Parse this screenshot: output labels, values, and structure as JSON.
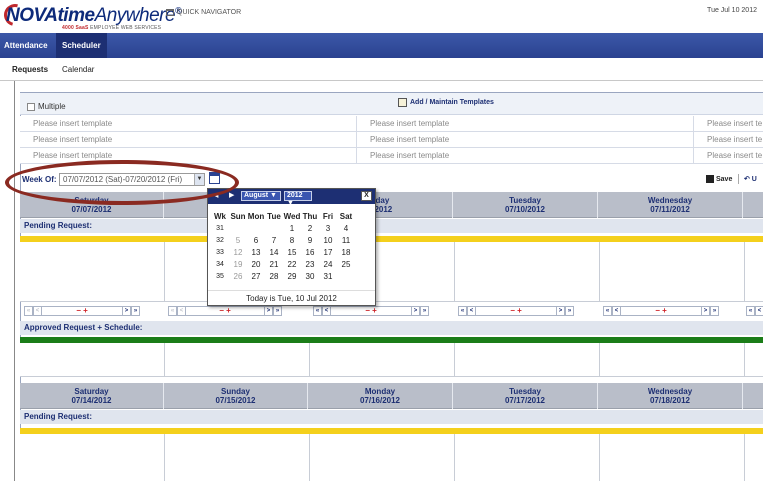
{
  "header": {
    "logo_main": "NOVAtime",
    "logo_anywhere": "Anywhere",
    "logo_reg": "®",
    "logo_sub_brand": "4000 SaaS",
    "logo_sub_text": "EMPLOYEE WEB SERVICES",
    "quick_navigator": "QUICK NAVIGATOR",
    "date": "Tue Jul 10 2012"
  },
  "nav": {
    "tabs": [
      {
        "label": "Attendance"
      },
      {
        "label": "Scheduler"
      }
    ]
  },
  "subtabs": [
    {
      "label": "Requests"
    },
    {
      "label": "Calendar"
    }
  ],
  "templates": {
    "multiple_label": "Multiple",
    "add_label": "Add / Maintain Templates",
    "placeholder": "Please insert template",
    "placeholder_cut": "Please insert te"
  },
  "week": {
    "label": "Week Of:",
    "value": "07/07/2012 (Sat)-07/20/2012 (Fri)",
    "save_label": "Save"
  },
  "week1": {
    "days": [
      {
        "name": "Saturday",
        "date": "07/07/2012"
      },
      {
        "name": "",
        "date": ""
      },
      {
        "name": "nday",
        "date": "9/2012"
      },
      {
        "name": "Tuesday",
        "date": "07/10/2012"
      },
      {
        "name": "Wednesday",
        "date": "07/11/2012"
      }
    ],
    "pending_label": "Pending Request:",
    "approved_label": "Approved Request + Schedule:"
  },
  "week2": {
    "days": [
      {
        "name": "Saturday",
        "date": "07/14/2012"
      },
      {
        "name": "Sunday",
        "date": "07/15/2012"
      },
      {
        "name": "Monday",
        "date": "07/16/2012"
      },
      {
        "name": "Tuesday",
        "date": "07/17/2012"
      },
      {
        "name": "Wednesday",
        "date": "07/18/2012"
      }
    ],
    "pending_label": "Pending Request:"
  },
  "pager": {
    "first": "«",
    "prev": "<",
    "next": ">",
    "last": "»",
    "minus_plus": "− +"
  },
  "calendar_popup": {
    "month": "August",
    "year": "2012",
    "close": "X",
    "headers": [
      "Wk",
      "Sun",
      "Mon",
      "Tue",
      "Wed",
      "Thu",
      "Fri",
      "Sat"
    ],
    "weeks": [
      [
        "31",
        "",
        "",
        "",
        "1",
        "2",
        "3",
        "4"
      ],
      [
        "32",
        "5",
        "6",
        "7",
        "8",
        "9",
        "10",
        "11"
      ],
      [
        "33",
        "12",
        "13",
        "14",
        "15",
        "16",
        "17",
        "18"
      ],
      [
        "34",
        "19",
        "20",
        "21",
        "22",
        "23",
        "24",
        "25"
      ],
      [
        "35",
        "26",
        "27",
        "28",
        "29",
        "30",
        "31",
        ""
      ]
    ],
    "today_text": "Today is Tue, 10 Jul 2012"
  },
  "colors": {
    "nav_blue": "#2a4290",
    "pending_bar": "#f4d01c",
    "approved_bar": "#1b7d18",
    "annotation": "#8a2a21"
  }
}
